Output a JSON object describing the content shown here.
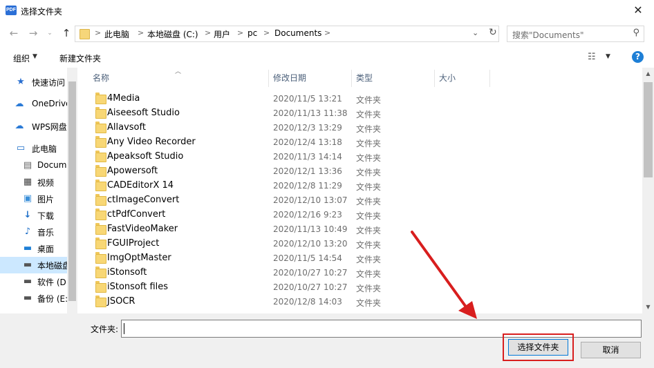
{
  "window": {
    "title": "选择文件夹",
    "app_icon_text": "PDF",
    "close_glyph": "✕"
  },
  "address_bar": {
    "breadcrumbs": [
      "此电脑",
      "本地磁盘 (C:)",
      "用户",
      "pc",
      "Documents"
    ],
    "separator": ">"
  },
  "search": {
    "placeholder": "搜索\"Documents\""
  },
  "toolbar": {
    "organize_label": "组织",
    "new_folder_label": "新建文件夹",
    "help_label": "?"
  },
  "sidebar": {
    "items": [
      {
        "label": "快速访问",
        "icon": "star-icon"
      },
      {
        "label": "OneDrive",
        "icon": "cloud-icon"
      },
      {
        "label": "WPS网盘",
        "icon": "cloud-icon"
      },
      {
        "label": "此电脑",
        "icon": "computer-icon"
      },
      {
        "label": "Documents",
        "icon": "document-icon"
      },
      {
        "label": "视频",
        "icon": "video-icon"
      },
      {
        "label": "图片",
        "icon": "picture-icon"
      },
      {
        "label": "下载",
        "icon": "download-icon"
      },
      {
        "label": "音乐",
        "icon": "music-icon"
      },
      {
        "label": "桌面",
        "icon": "desktop-icon"
      },
      {
        "label": "本地磁盘 (C:)",
        "icon": "drive-icon",
        "selected": true
      },
      {
        "label": "软件 (D:)",
        "icon": "drive-icon"
      },
      {
        "label": "备份 (E:)",
        "icon": "drive-icon"
      }
    ]
  },
  "columns": {
    "name": "名称",
    "modified": "修改日期",
    "type": "类型",
    "size": "大小"
  },
  "files": [
    {
      "name": "4Media",
      "modified": "2020/11/5 13:21",
      "type": "文件夹"
    },
    {
      "name": "Aiseesoft Studio",
      "modified": "2020/11/13 11:38",
      "type": "文件夹"
    },
    {
      "name": "Allavsoft",
      "modified": "2020/12/3 13:29",
      "type": "文件夹"
    },
    {
      "name": "Any Video Recorder",
      "modified": "2020/12/4 13:18",
      "type": "文件夹"
    },
    {
      "name": "Apeaksoft Studio",
      "modified": "2020/11/3 14:14",
      "type": "文件夹"
    },
    {
      "name": "Apowersoft",
      "modified": "2020/12/1 13:36",
      "type": "文件夹"
    },
    {
      "name": "CADEditorX 14",
      "modified": "2020/12/8 11:29",
      "type": "文件夹"
    },
    {
      "name": "ctImageConvert",
      "modified": "2020/12/10 13:07",
      "type": "文件夹"
    },
    {
      "name": "ctPdfConvert",
      "modified": "2020/12/16 9:23",
      "type": "文件夹"
    },
    {
      "name": "FastVideoMaker",
      "modified": "2020/11/13 10:49",
      "type": "文件夹"
    },
    {
      "name": "FGUIProject",
      "modified": "2020/12/10 13:20",
      "type": "文件夹"
    },
    {
      "name": "ImgOptMaster",
      "modified": "2020/11/5 14:54",
      "type": "文件夹"
    },
    {
      "name": "iStonsoft",
      "modified": "2020/10/27 10:27",
      "type": "文件夹"
    },
    {
      "name": "iStonsoft files",
      "modified": "2020/10/27 10:27",
      "type": "文件夹"
    },
    {
      "name": "JSOCR",
      "modified": "2020/12/8 14:03",
      "type": "文件夹"
    }
  ],
  "footer": {
    "folder_label": "文件夹:",
    "folder_value": "",
    "select_button": "选择文件夹",
    "cancel_button": "取消"
  },
  "colors": {
    "annotation_red": "#d81e1e",
    "selection_blue": "#cce8ff",
    "accent": "#0078d7"
  }
}
